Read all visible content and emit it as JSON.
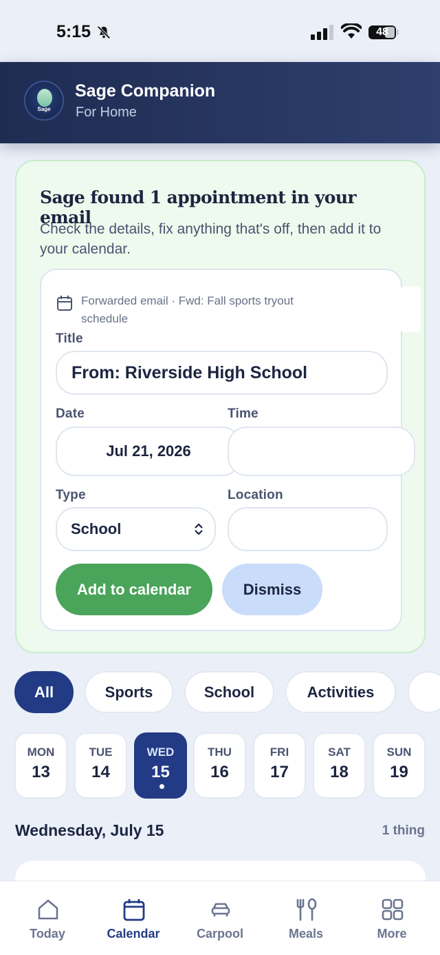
{
  "status_bar": {
    "time": "5:15",
    "battery": "48"
  },
  "header": {
    "logo_text": "Sage",
    "title": "Sage Companion",
    "subtitle": "For Home"
  },
  "found_card": {
    "title": "Sage found 1 appointment in your email",
    "description": "Check the details, fix anything that's off, then add it to your calendar.",
    "source": "Forwarded email · Fwd: Fall sports tryout schedule",
    "fields": {
      "title_label": "Title",
      "title_value": "From: Riverside High School",
      "date_label": "Date",
      "date_value": "Jul 21, 2026",
      "time_label": "Time",
      "time_value": "",
      "type_label": "Type",
      "type_value": "School",
      "location_label": "Location",
      "location_value": ""
    },
    "add_button": "Add to calendar",
    "dismiss_button": "Dismiss"
  },
  "filters": [
    "All",
    "Sports",
    "School",
    "Activities"
  ],
  "week": [
    {
      "day": "MON",
      "num": "13"
    },
    {
      "day": "TUE",
      "num": "14"
    },
    {
      "day": "WED",
      "num": "15"
    },
    {
      "day": "THU",
      "num": "16"
    },
    {
      "day": "FRI",
      "num": "17"
    },
    {
      "day": "SAT",
      "num": "18"
    },
    {
      "day": "SUN",
      "num": "19"
    }
  ],
  "selected_day": {
    "heading": "Wednesday, July 15",
    "count": "1 thing"
  },
  "nav": [
    {
      "label": "Today",
      "icon": "home-icon"
    },
    {
      "label": "Calendar",
      "icon": "calendar-icon"
    },
    {
      "label": "Carpool",
      "icon": "car-icon"
    },
    {
      "label": "Meals",
      "icon": "utensils-icon"
    },
    {
      "label": "More",
      "icon": "grid-icon"
    }
  ],
  "colors": {
    "accent": "#233b85",
    "success": "#4aa45a",
    "header": "#1f2c52"
  }
}
